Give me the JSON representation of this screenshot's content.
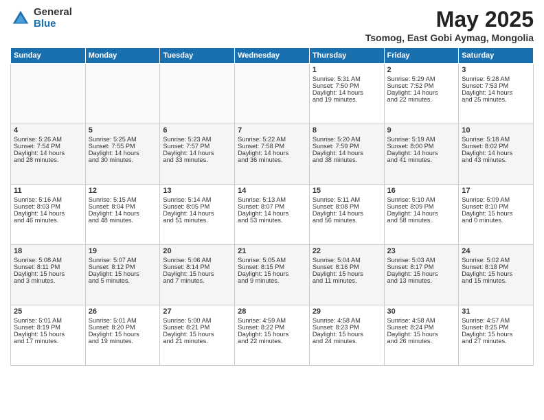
{
  "logo": {
    "general": "General",
    "blue": "Blue"
  },
  "title": "May 2025",
  "subtitle": "Tsomog, East Gobi Aymag, Mongolia",
  "days_of_week": [
    "Sunday",
    "Monday",
    "Tuesday",
    "Wednesday",
    "Thursday",
    "Friday",
    "Saturday"
  ],
  "weeks": [
    [
      {
        "day": "",
        "info": ""
      },
      {
        "day": "",
        "info": ""
      },
      {
        "day": "",
        "info": ""
      },
      {
        "day": "",
        "info": ""
      },
      {
        "day": "1",
        "info": "Sunrise: 5:31 AM\nSunset: 7:50 PM\nDaylight: 14 hours\nand 19 minutes."
      },
      {
        "day": "2",
        "info": "Sunrise: 5:29 AM\nSunset: 7:52 PM\nDaylight: 14 hours\nand 22 minutes."
      },
      {
        "day": "3",
        "info": "Sunrise: 5:28 AM\nSunset: 7:53 PM\nDaylight: 14 hours\nand 25 minutes."
      }
    ],
    [
      {
        "day": "4",
        "info": "Sunrise: 5:26 AM\nSunset: 7:54 PM\nDaylight: 14 hours\nand 28 minutes."
      },
      {
        "day": "5",
        "info": "Sunrise: 5:25 AM\nSunset: 7:55 PM\nDaylight: 14 hours\nand 30 minutes."
      },
      {
        "day": "6",
        "info": "Sunrise: 5:23 AM\nSunset: 7:57 PM\nDaylight: 14 hours\nand 33 minutes."
      },
      {
        "day": "7",
        "info": "Sunrise: 5:22 AM\nSunset: 7:58 PM\nDaylight: 14 hours\nand 36 minutes."
      },
      {
        "day": "8",
        "info": "Sunrise: 5:20 AM\nSunset: 7:59 PM\nDaylight: 14 hours\nand 38 minutes."
      },
      {
        "day": "9",
        "info": "Sunrise: 5:19 AM\nSunset: 8:00 PM\nDaylight: 14 hours\nand 41 minutes."
      },
      {
        "day": "10",
        "info": "Sunrise: 5:18 AM\nSunset: 8:02 PM\nDaylight: 14 hours\nand 43 minutes."
      }
    ],
    [
      {
        "day": "11",
        "info": "Sunrise: 5:16 AM\nSunset: 8:03 PM\nDaylight: 14 hours\nand 46 minutes."
      },
      {
        "day": "12",
        "info": "Sunrise: 5:15 AM\nSunset: 8:04 PM\nDaylight: 14 hours\nand 48 minutes."
      },
      {
        "day": "13",
        "info": "Sunrise: 5:14 AM\nSunset: 8:05 PM\nDaylight: 14 hours\nand 51 minutes."
      },
      {
        "day": "14",
        "info": "Sunrise: 5:13 AM\nSunset: 8:07 PM\nDaylight: 14 hours\nand 53 minutes."
      },
      {
        "day": "15",
        "info": "Sunrise: 5:11 AM\nSunset: 8:08 PM\nDaylight: 14 hours\nand 56 minutes."
      },
      {
        "day": "16",
        "info": "Sunrise: 5:10 AM\nSunset: 8:09 PM\nDaylight: 14 hours\nand 58 minutes."
      },
      {
        "day": "17",
        "info": "Sunrise: 5:09 AM\nSunset: 8:10 PM\nDaylight: 15 hours\nand 0 minutes."
      }
    ],
    [
      {
        "day": "18",
        "info": "Sunrise: 5:08 AM\nSunset: 8:11 PM\nDaylight: 15 hours\nand 3 minutes."
      },
      {
        "day": "19",
        "info": "Sunrise: 5:07 AM\nSunset: 8:12 PM\nDaylight: 15 hours\nand 5 minutes."
      },
      {
        "day": "20",
        "info": "Sunrise: 5:06 AM\nSunset: 8:14 PM\nDaylight: 15 hours\nand 7 minutes."
      },
      {
        "day": "21",
        "info": "Sunrise: 5:05 AM\nSunset: 8:15 PM\nDaylight: 15 hours\nand 9 minutes."
      },
      {
        "day": "22",
        "info": "Sunrise: 5:04 AM\nSunset: 8:16 PM\nDaylight: 15 hours\nand 11 minutes."
      },
      {
        "day": "23",
        "info": "Sunrise: 5:03 AM\nSunset: 8:17 PM\nDaylight: 15 hours\nand 13 minutes."
      },
      {
        "day": "24",
        "info": "Sunrise: 5:02 AM\nSunset: 8:18 PM\nDaylight: 15 hours\nand 15 minutes."
      }
    ],
    [
      {
        "day": "25",
        "info": "Sunrise: 5:01 AM\nSunset: 8:19 PM\nDaylight: 15 hours\nand 17 minutes."
      },
      {
        "day": "26",
        "info": "Sunrise: 5:01 AM\nSunset: 8:20 PM\nDaylight: 15 hours\nand 19 minutes."
      },
      {
        "day": "27",
        "info": "Sunrise: 5:00 AM\nSunset: 8:21 PM\nDaylight: 15 hours\nand 21 minutes."
      },
      {
        "day": "28",
        "info": "Sunrise: 4:59 AM\nSunset: 8:22 PM\nDaylight: 15 hours\nand 22 minutes."
      },
      {
        "day": "29",
        "info": "Sunrise: 4:58 AM\nSunset: 8:23 PM\nDaylight: 15 hours\nand 24 minutes."
      },
      {
        "day": "30",
        "info": "Sunrise: 4:58 AM\nSunset: 8:24 PM\nDaylight: 15 hours\nand 26 minutes."
      },
      {
        "day": "31",
        "info": "Sunrise: 4:57 AM\nSunset: 8:25 PM\nDaylight: 15 hours\nand 27 minutes."
      }
    ]
  ]
}
